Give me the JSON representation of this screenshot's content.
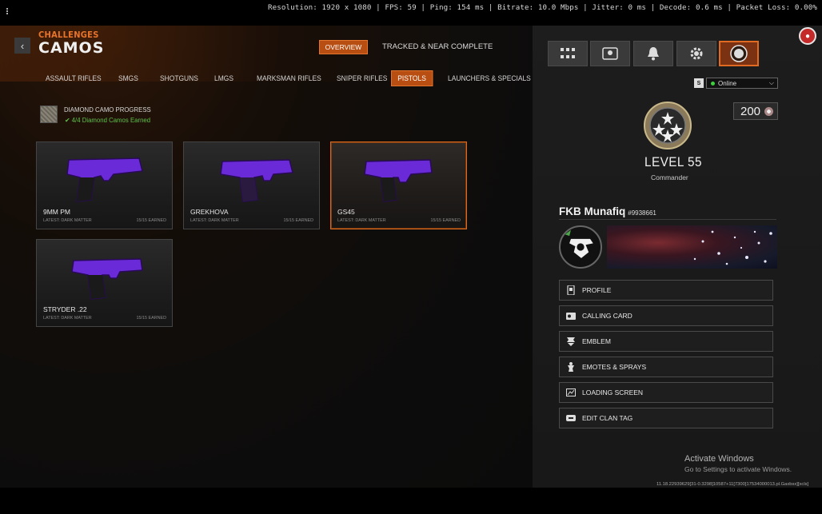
{
  "overlay": {
    "stats": "Resolution: 1920 x 1080 | FPS: 59 | Ping: 154 ms | Bitrate: 10.0 Mbps | Jitter: 0 ms | Decode: 0.6 ms | Packet Loss: 0.00%"
  },
  "header": {
    "back_icon": "chevron-left",
    "section": "CHALLENGES",
    "title": "CAMOS",
    "tabs": [
      {
        "label": "OVERVIEW",
        "active": true
      },
      {
        "label": "TRACKED & NEAR COMPLETE",
        "active": false
      }
    ]
  },
  "categories": [
    {
      "label": "ASSAULT RIFLES",
      "active": false
    },
    {
      "label": "SMGS",
      "active": false
    },
    {
      "label": "SHOTGUNS",
      "active": false
    },
    {
      "label": "LMGS",
      "active": false
    },
    {
      "label": "MARKSMAN RIFLES",
      "active": false
    },
    {
      "label": "SNIPER RIFLES",
      "active": false
    },
    {
      "label": "PISTOLS",
      "active": true
    },
    {
      "label": "LAUNCHERS & SPECIALS",
      "active": false
    }
  ],
  "progress": {
    "title": "DIAMOND CAMO PROGRESS",
    "subtitle": "4/4 Diamond Camos Earned",
    "accent": "#5fc04a"
  },
  "weapons": [
    {
      "name": "9MM PM",
      "latest": "LATEST: DARK MATTER",
      "earned": "15/15 EARNED",
      "selected": false
    },
    {
      "name": "GREKHOVA",
      "latest": "LATEST: DARK MATTER",
      "earned": "15/15 EARNED",
      "selected": false
    },
    {
      "name": "GS45",
      "latest": "LATEST: DARK MATTER",
      "earned": "15/15 EARNED",
      "selected": true
    },
    {
      "name": "STRYDER .22",
      "latest": "LATEST: DARK MATTER",
      "earned": "15/15 EARNED",
      "selected": false
    }
  ],
  "sidebar": {
    "top_icons": [
      "grid-icon",
      "barracks-icon",
      "bell-icon",
      "gear-icon",
      "emblem-badge-icon"
    ],
    "platform_badge": "S",
    "status": "Online",
    "cod_points": "200",
    "level": "LEVEL 55",
    "rank_title": "Commander",
    "player_name": "FKB Munafiq",
    "player_id": "#9938661",
    "menu": [
      {
        "label": "PROFILE",
        "icon": "profile-icon"
      },
      {
        "label": "CALLING CARD",
        "icon": "calling-card-icon"
      },
      {
        "label": "EMBLEM",
        "icon": "emblem-icon"
      },
      {
        "label": "EMOTES & SPRAYS",
        "icon": "emote-icon"
      },
      {
        "label": "LOADING SCREEN",
        "icon": "loading-screen-icon"
      },
      {
        "label": "EDIT CLAN TAG",
        "icon": "clan-tag-icon"
      }
    ]
  },
  "watermark": {
    "line1": "Activate Windows",
    "line2": "Go to Settings to activate Windows."
  },
  "version": "11.18.22939629[31-0.3298]10587+11[7300]17534000013.pl.Gaxbsx][xcls]",
  "colors": {
    "accent": "#e8742a",
    "active_tab": "#b94e12",
    "camo": "#6a2ad8"
  }
}
